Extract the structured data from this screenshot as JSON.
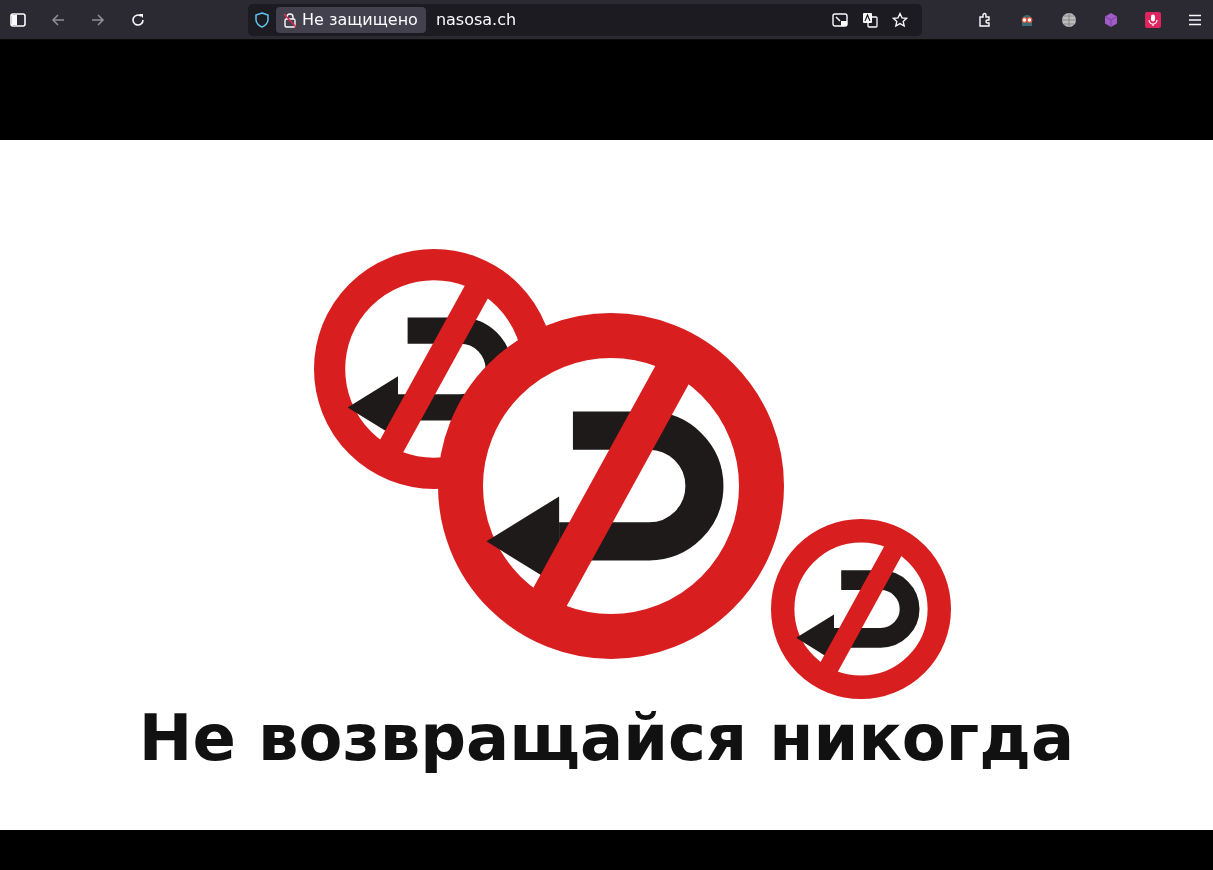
{
  "toolbar": {
    "nav_buttons": [
      {
        "kind": "back",
        "disabled": true
      },
      {
        "kind": "forward",
        "disabled": true
      },
      {
        "kind": "reload",
        "disabled": false
      }
    ],
    "address_bar": {
      "security_label": "Не защищено",
      "url": "nasosa.ch"
    }
  },
  "page": {
    "headline": "Не возвращайся никогда"
  }
}
